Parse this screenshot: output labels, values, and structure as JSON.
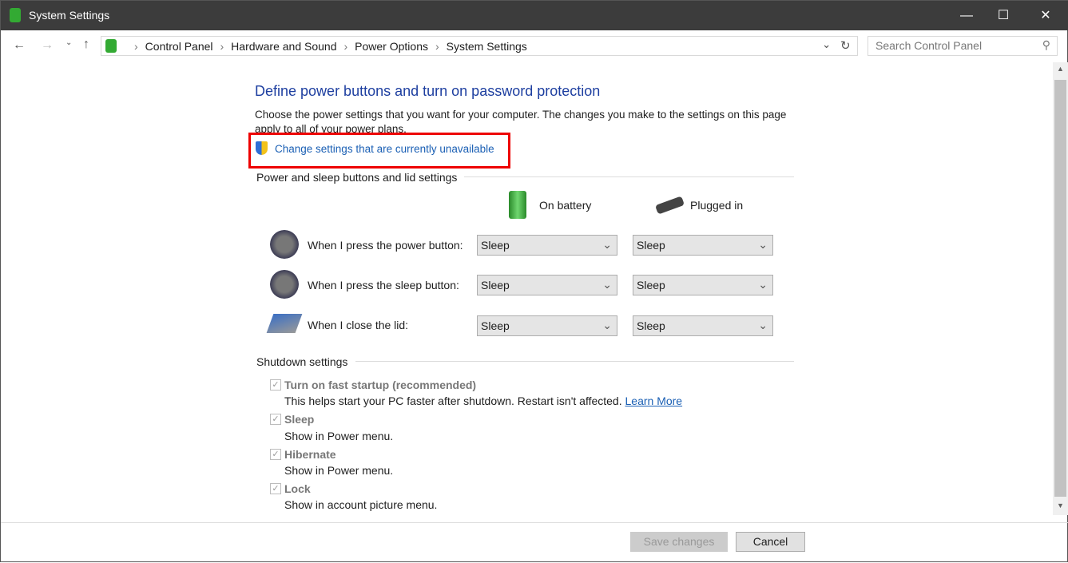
{
  "window": {
    "title": "System Settings"
  },
  "breadcrumb": [
    "Control Panel",
    "Hardware and Sound",
    "Power Options",
    "System Settings"
  ],
  "search": {
    "placeholder": "Search Control Panel"
  },
  "page": {
    "title": "Define power buttons and turn on password protection",
    "description": "Choose the power settings that you want for your computer. The changes you make to the settings on this page apply to all of your power plans.",
    "change_link": "Change settings that are currently unavailable"
  },
  "power_section": {
    "title": "Power and sleep buttons and lid settings",
    "col_battery": "On battery",
    "col_plugged": "Plugged in",
    "rows": [
      {
        "label": "When I press the power button:",
        "battery": "Sleep",
        "plugged": "Sleep"
      },
      {
        "label": "When I press the sleep button:",
        "battery": "Sleep",
        "plugged": "Sleep"
      },
      {
        "label": "When I close the lid:",
        "battery": "Sleep",
        "plugged": "Sleep"
      }
    ]
  },
  "shutdown": {
    "title": "Shutdown settings",
    "items": [
      {
        "title": "Turn on fast startup (recommended)",
        "desc": "This helps start your PC faster after shutdown. Restart isn't affected.",
        "link": "Learn More",
        "checked": true
      },
      {
        "title": "Sleep",
        "desc": "Show in Power menu.",
        "checked": true
      },
      {
        "title": "Hibernate",
        "desc": "Show in Power menu.",
        "checked": true
      },
      {
        "title": "Lock",
        "desc": "Show in account picture menu.",
        "checked": true
      }
    ]
  },
  "buttons": {
    "save": "Save changes",
    "cancel": "Cancel"
  }
}
